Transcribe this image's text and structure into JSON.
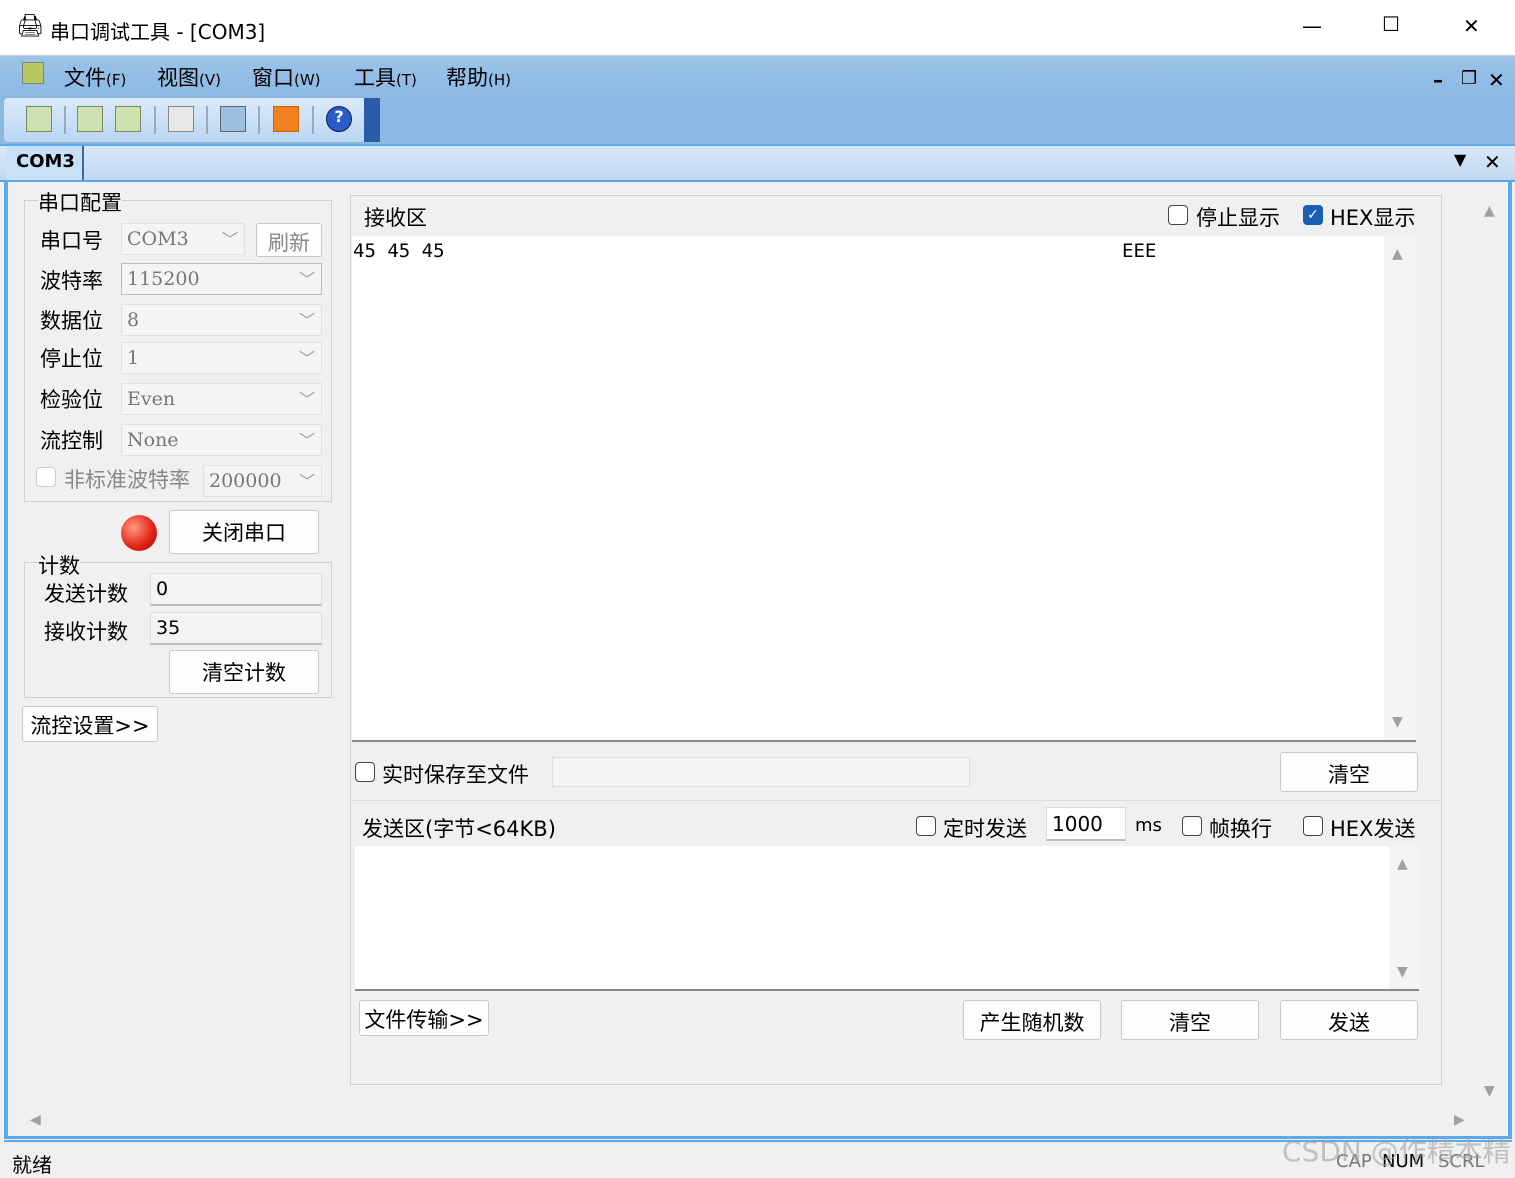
{
  "window": {
    "title": "串口调试工具 - [COM3]",
    "minimize": "—",
    "maximize": "☐",
    "close": "✕"
  },
  "menu": [
    {
      "label": "文件",
      "key": "(F)"
    },
    {
      "label": "视图",
      "key": "(V)"
    },
    {
      "label": "窗口",
      "key": "(W)"
    },
    {
      "label": "工具",
      "key": "(T)"
    },
    {
      "label": "帮助",
      "key": "(H)"
    }
  ],
  "mdi_controls": {
    "minimize": "–",
    "restore": "❐",
    "close": "✕"
  },
  "tab": {
    "label": "COM3"
  },
  "serial": {
    "group": "串口配置",
    "port_label": "串口号",
    "port": "COM3",
    "refresh": "刷新",
    "baud_label": "波特率",
    "baud": "115200",
    "data_label": "数据位",
    "data": "8",
    "stop_label": "停止位",
    "stop": "1",
    "parity_label": "检验位",
    "parity": "Even",
    "flow_label": "流控制",
    "flow": "None",
    "nonstd_label": "非标准波特率",
    "nonstd": "200000",
    "close_port": "关闭串口",
    "status_color": "#e02010"
  },
  "count": {
    "group": "计数",
    "send_label": "发送计数",
    "send": "0",
    "recv_label": "接收计数",
    "recv": "35",
    "clear": "清空计数"
  },
  "flow_settings": "流控设置>>",
  "receive": {
    "title": "接收区",
    "stop_display": "停止显示",
    "hex_display": "HEX显示",
    "hex_text": "45 45 45",
    "ascii_text": "EEE",
    "save_file": "实时保存至文件",
    "clear": "清空"
  },
  "send": {
    "title": "发送区(字节<64KB)",
    "timed": "定时发送",
    "interval": "1000",
    "unit": "ms",
    "newline": "帧换行",
    "hex_send": "HEX发送",
    "file_transfer": "文件传输>>",
    "random": "产生随机数",
    "clear": "清空",
    "send": "发送"
  },
  "status": {
    "text": "就绪",
    "cap": "CAP",
    "num": "NUM",
    "scrl": "SCRL"
  },
  "watermark": "CSDN @作精本精"
}
